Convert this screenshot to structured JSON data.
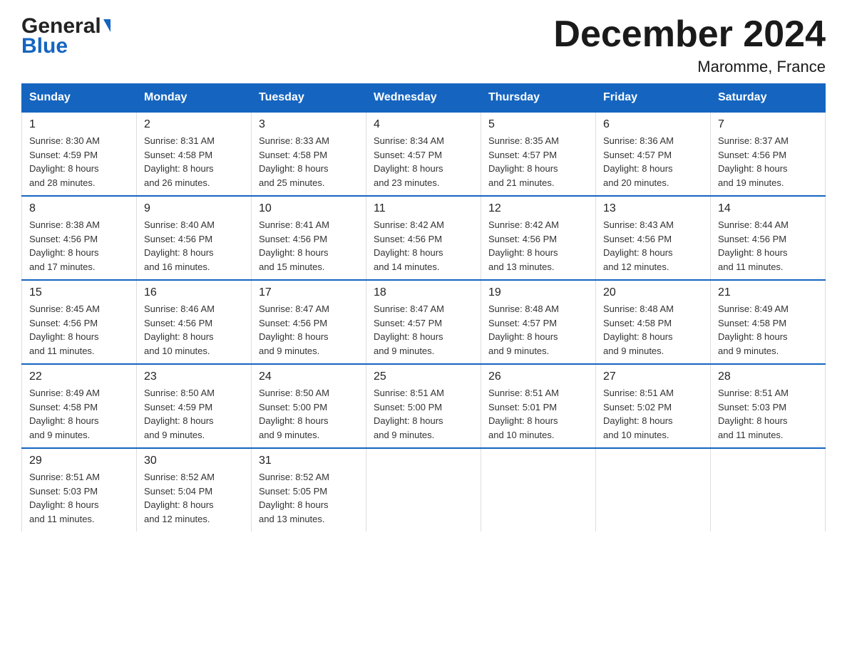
{
  "header": {
    "logo_general": "General",
    "logo_blue": "Blue",
    "month_title": "December 2024",
    "location": "Maromme, France"
  },
  "days_of_week": [
    "Sunday",
    "Monday",
    "Tuesday",
    "Wednesday",
    "Thursday",
    "Friday",
    "Saturday"
  ],
  "weeks": [
    [
      {
        "day": "1",
        "sunrise": "8:30 AM",
        "sunset": "4:59 PM",
        "daylight": "8 hours and 28 minutes."
      },
      {
        "day": "2",
        "sunrise": "8:31 AM",
        "sunset": "4:58 PM",
        "daylight": "8 hours and 26 minutes."
      },
      {
        "day": "3",
        "sunrise": "8:33 AM",
        "sunset": "4:58 PM",
        "daylight": "8 hours and 25 minutes."
      },
      {
        "day": "4",
        "sunrise": "8:34 AM",
        "sunset": "4:57 PM",
        "daylight": "8 hours and 23 minutes."
      },
      {
        "day": "5",
        "sunrise": "8:35 AM",
        "sunset": "4:57 PM",
        "daylight": "8 hours and 21 minutes."
      },
      {
        "day": "6",
        "sunrise": "8:36 AM",
        "sunset": "4:57 PM",
        "daylight": "8 hours and 20 minutes."
      },
      {
        "day": "7",
        "sunrise": "8:37 AM",
        "sunset": "4:56 PM",
        "daylight": "8 hours and 19 minutes."
      }
    ],
    [
      {
        "day": "8",
        "sunrise": "8:38 AM",
        "sunset": "4:56 PM",
        "daylight": "8 hours and 17 minutes."
      },
      {
        "day": "9",
        "sunrise": "8:40 AM",
        "sunset": "4:56 PM",
        "daylight": "8 hours and 16 minutes."
      },
      {
        "day": "10",
        "sunrise": "8:41 AM",
        "sunset": "4:56 PM",
        "daylight": "8 hours and 15 minutes."
      },
      {
        "day": "11",
        "sunrise": "8:42 AM",
        "sunset": "4:56 PM",
        "daylight": "8 hours and 14 minutes."
      },
      {
        "day": "12",
        "sunrise": "8:42 AM",
        "sunset": "4:56 PM",
        "daylight": "8 hours and 13 minutes."
      },
      {
        "day": "13",
        "sunrise": "8:43 AM",
        "sunset": "4:56 PM",
        "daylight": "8 hours and 12 minutes."
      },
      {
        "day": "14",
        "sunrise": "8:44 AM",
        "sunset": "4:56 PM",
        "daylight": "8 hours and 11 minutes."
      }
    ],
    [
      {
        "day": "15",
        "sunrise": "8:45 AM",
        "sunset": "4:56 PM",
        "daylight": "8 hours and 11 minutes."
      },
      {
        "day": "16",
        "sunrise": "8:46 AM",
        "sunset": "4:56 PM",
        "daylight": "8 hours and 10 minutes."
      },
      {
        "day": "17",
        "sunrise": "8:47 AM",
        "sunset": "4:56 PM",
        "daylight": "8 hours and 9 minutes."
      },
      {
        "day": "18",
        "sunrise": "8:47 AM",
        "sunset": "4:57 PM",
        "daylight": "8 hours and 9 minutes."
      },
      {
        "day": "19",
        "sunrise": "8:48 AM",
        "sunset": "4:57 PM",
        "daylight": "8 hours and 9 minutes."
      },
      {
        "day": "20",
        "sunrise": "8:48 AM",
        "sunset": "4:58 PM",
        "daylight": "8 hours and 9 minutes."
      },
      {
        "day": "21",
        "sunrise": "8:49 AM",
        "sunset": "4:58 PM",
        "daylight": "8 hours and 9 minutes."
      }
    ],
    [
      {
        "day": "22",
        "sunrise": "8:49 AM",
        "sunset": "4:58 PM",
        "daylight": "8 hours and 9 minutes."
      },
      {
        "day": "23",
        "sunrise": "8:50 AM",
        "sunset": "4:59 PM",
        "daylight": "8 hours and 9 minutes."
      },
      {
        "day": "24",
        "sunrise": "8:50 AM",
        "sunset": "5:00 PM",
        "daylight": "8 hours and 9 minutes."
      },
      {
        "day": "25",
        "sunrise": "8:51 AM",
        "sunset": "5:00 PM",
        "daylight": "8 hours and 9 minutes."
      },
      {
        "day": "26",
        "sunrise": "8:51 AM",
        "sunset": "5:01 PM",
        "daylight": "8 hours and 10 minutes."
      },
      {
        "day": "27",
        "sunrise": "8:51 AM",
        "sunset": "5:02 PM",
        "daylight": "8 hours and 10 minutes."
      },
      {
        "day": "28",
        "sunrise": "8:51 AM",
        "sunset": "5:03 PM",
        "daylight": "8 hours and 11 minutes."
      }
    ],
    [
      {
        "day": "29",
        "sunrise": "8:51 AM",
        "sunset": "5:03 PM",
        "daylight": "8 hours and 11 minutes."
      },
      {
        "day": "30",
        "sunrise": "8:52 AM",
        "sunset": "5:04 PM",
        "daylight": "8 hours and 12 minutes."
      },
      {
        "day": "31",
        "sunrise": "8:52 AM",
        "sunset": "5:05 PM",
        "daylight": "8 hours and 13 minutes."
      },
      null,
      null,
      null,
      null
    ]
  ],
  "labels": {
    "sunrise": "Sunrise:",
    "sunset": "Sunset:",
    "daylight": "Daylight:"
  }
}
